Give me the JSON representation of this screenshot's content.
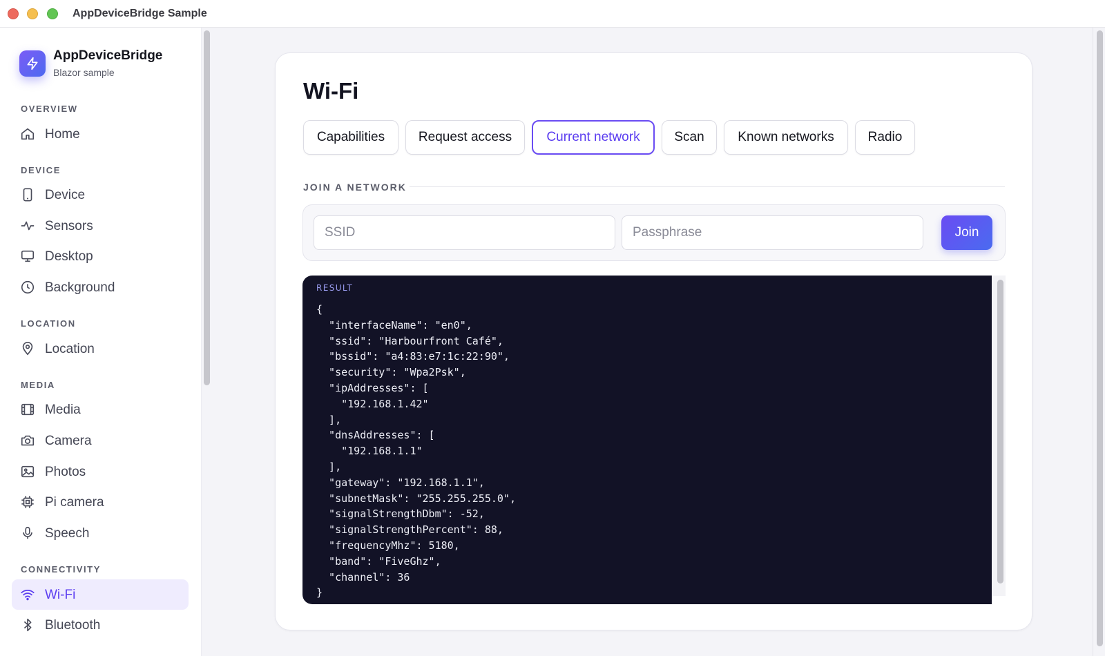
{
  "window": {
    "title": "AppDeviceBridge Sample"
  },
  "brand": {
    "name": "AppDeviceBridge",
    "subtitle": "Blazor sample"
  },
  "sidebar": {
    "sections": [
      {
        "label": "OVERVIEW"
      },
      {
        "label": "DEVICE"
      },
      {
        "label": "LOCATION"
      },
      {
        "label": "MEDIA"
      },
      {
        "label": "CONNECTIVITY"
      }
    ],
    "items": [
      {
        "label": "Home",
        "icon": "home-icon"
      },
      {
        "label": "Device",
        "icon": "phone-icon"
      },
      {
        "label": "Sensors",
        "icon": "activity-icon"
      },
      {
        "label": "Desktop",
        "icon": "monitor-icon"
      },
      {
        "label": "Background",
        "icon": "clock-icon"
      },
      {
        "label": "Location",
        "icon": "map-pin-icon"
      },
      {
        "label": "Media",
        "icon": "film-icon"
      },
      {
        "label": "Camera",
        "icon": "camera-icon"
      },
      {
        "label": "Photos",
        "icon": "image-icon"
      },
      {
        "label": "Pi camera",
        "icon": "chip-icon"
      },
      {
        "label": "Speech",
        "icon": "microphone-icon"
      },
      {
        "label": "Wi-Fi",
        "icon": "wifi-icon",
        "active": true
      },
      {
        "label": "Bluetooth",
        "icon": "bluetooth-icon"
      }
    ]
  },
  "page": {
    "title": "Wi-Fi",
    "tabs": [
      {
        "label": "Capabilities"
      },
      {
        "label": "Request access"
      },
      {
        "label": "Current network",
        "active": true
      },
      {
        "label": "Scan"
      },
      {
        "label": "Known networks"
      },
      {
        "label": "Radio"
      }
    ],
    "join": {
      "section_label": "JOIN A NETWORK",
      "ssid_placeholder": "SSID",
      "passphrase_placeholder": "Passphrase",
      "button_label": "Join"
    },
    "result": {
      "label": "RESULT",
      "text": "{\n  \"interfaceName\": \"en0\",\n  \"ssid\": \"Harbourfront Café\",\n  \"bssid\": \"a4:83:e7:1c:22:90\",\n  \"security\": \"Wpa2Psk\",\n  \"ipAddresses\": [\n    \"192.168.1.42\"\n  ],\n  \"dnsAddresses\": [\n    \"192.168.1.1\"\n  ],\n  \"gateway\": \"192.168.1.1\",\n  \"subnetMask\": \"255.255.255.0\",\n  \"signalStrengthDbm\": -52,\n  \"signalStrengthPercent\": 88,\n  \"frequencyMhz\": 5180,\n  \"band\": \"FiveGhz\",\n  \"channel\": 36\n}"
    }
  },
  "colors": {
    "accent": "#5b3df0",
    "result_bg": "#121226",
    "active_nav_bg": "#efecfe"
  }
}
